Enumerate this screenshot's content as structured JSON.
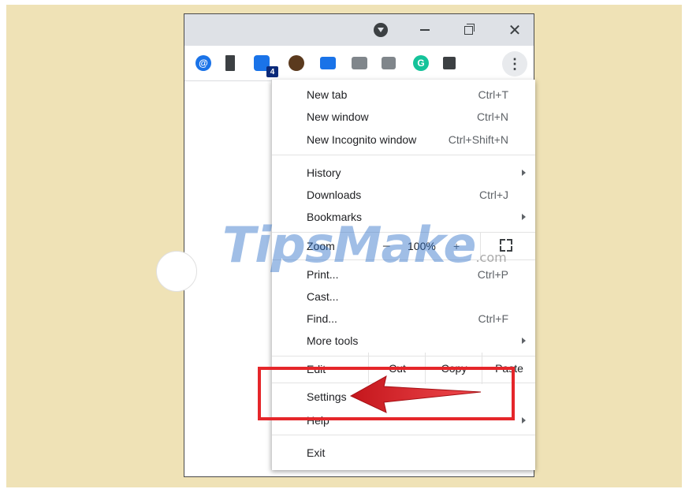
{
  "titlebar": {
    "profile_icon": "chrome-profile-icon",
    "minimize_symbol": "—",
    "restore_icon": "restore-window-icon",
    "close_symbol": "✕"
  },
  "toolbar": {
    "extensions": [
      {
        "name": "at-sign-extension-icon",
        "glyph": "@"
      },
      {
        "name": "bookmark-extension-icon",
        "glyph": ""
      },
      {
        "name": "bird-extension-icon",
        "glyph": "",
        "badge": "4"
      },
      {
        "name": "man-face-extension-icon",
        "glyph": ""
      },
      {
        "name": "slides-extension-icon",
        "glyph": ""
      },
      {
        "name": "camera-extension-icon",
        "glyph": ""
      },
      {
        "name": "screen-extension-icon",
        "glyph": ""
      },
      {
        "name": "grammarly-extension-icon",
        "glyph": "G"
      },
      {
        "name": "puzzle-extension-icon",
        "glyph": ""
      }
    ],
    "menu_button_symbol": "⋮"
  },
  "menu": {
    "new_tab": {
      "label": "New tab",
      "shortcut": "Ctrl+T"
    },
    "new_window": {
      "label": "New window",
      "shortcut": "Ctrl+N"
    },
    "new_incognito": {
      "label": "New Incognito window",
      "shortcut": "Ctrl+Shift+N"
    },
    "history": {
      "label": "History"
    },
    "downloads": {
      "label": "Downloads",
      "shortcut": "Ctrl+J"
    },
    "bookmarks": {
      "label": "Bookmarks"
    },
    "zoom": {
      "label": "Zoom",
      "minus": "−",
      "value": "100%",
      "plus": "+"
    },
    "print": {
      "label": "Print...",
      "shortcut": "Ctrl+P"
    },
    "cast": {
      "label": "Cast..."
    },
    "find": {
      "label": "Find...",
      "shortcut": "Ctrl+F"
    },
    "more_tools": {
      "label": "More tools"
    },
    "edit": {
      "label": "Edit",
      "cut": "Cut",
      "copy": "Copy",
      "paste": "Paste"
    },
    "settings": {
      "label": "Settings"
    },
    "help": {
      "label": "Help"
    },
    "exit": {
      "label": "Exit"
    }
  },
  "watermark": {
    "text": "TipsMake",
    "suffix": ".com"
  },
  "annotation": {
    "highlight_color": "#e5262a"
  }
}
